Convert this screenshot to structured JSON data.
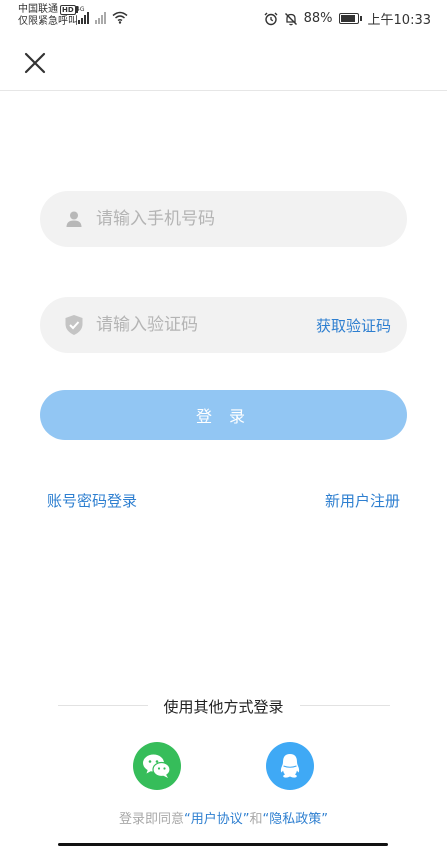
{
  "status_bar": {
    "carrier_line1": "中国联通",
    "hd_badge": "HD",
    "carrier_line2": "仅限紧急呼叫",
    "network_tag": "4G",
    "battery_percent": "88%",
    "battery_level": 0.88,
    "time": "上午10:33"
  },
  "header": {
    "close_icon": "close-icon"
  },
  "form": {
    "phone_placeholder": "请输入手机号码",
    "phone_value": "",
    "code_placeholder": "请输入验证码",
    "code_value": "",
    "get_code_label": "获取验证码",
    "login_label": "登 录"
  },
  "links": {
    "password_login": "账号密码登录",
    "register": "新用户注册"
  },
  "other_login": {
    "title": "使用其他方式登录",
    "methods": [
      {
        "name": "wechat",
        "icon": "wechat-icon",
        "color": "#36bd5a"
      },
      {
        "name": "qq",
        "icon": "qq-icon",
        "color": "#3fa9f5"
      }
    ]
  },
  "agreement": {
    "prefix": "登录即同意",
    "user_agreement": "“用户协议”",
    "connector": "和",
    "privacy_policy": "“隐私政策”"
  },
  "colors": {
    "accent": "#2e7fd0",
    "login_button": "#92c6f3",
    "input_bg": "#f2f2f2"
  }
}
